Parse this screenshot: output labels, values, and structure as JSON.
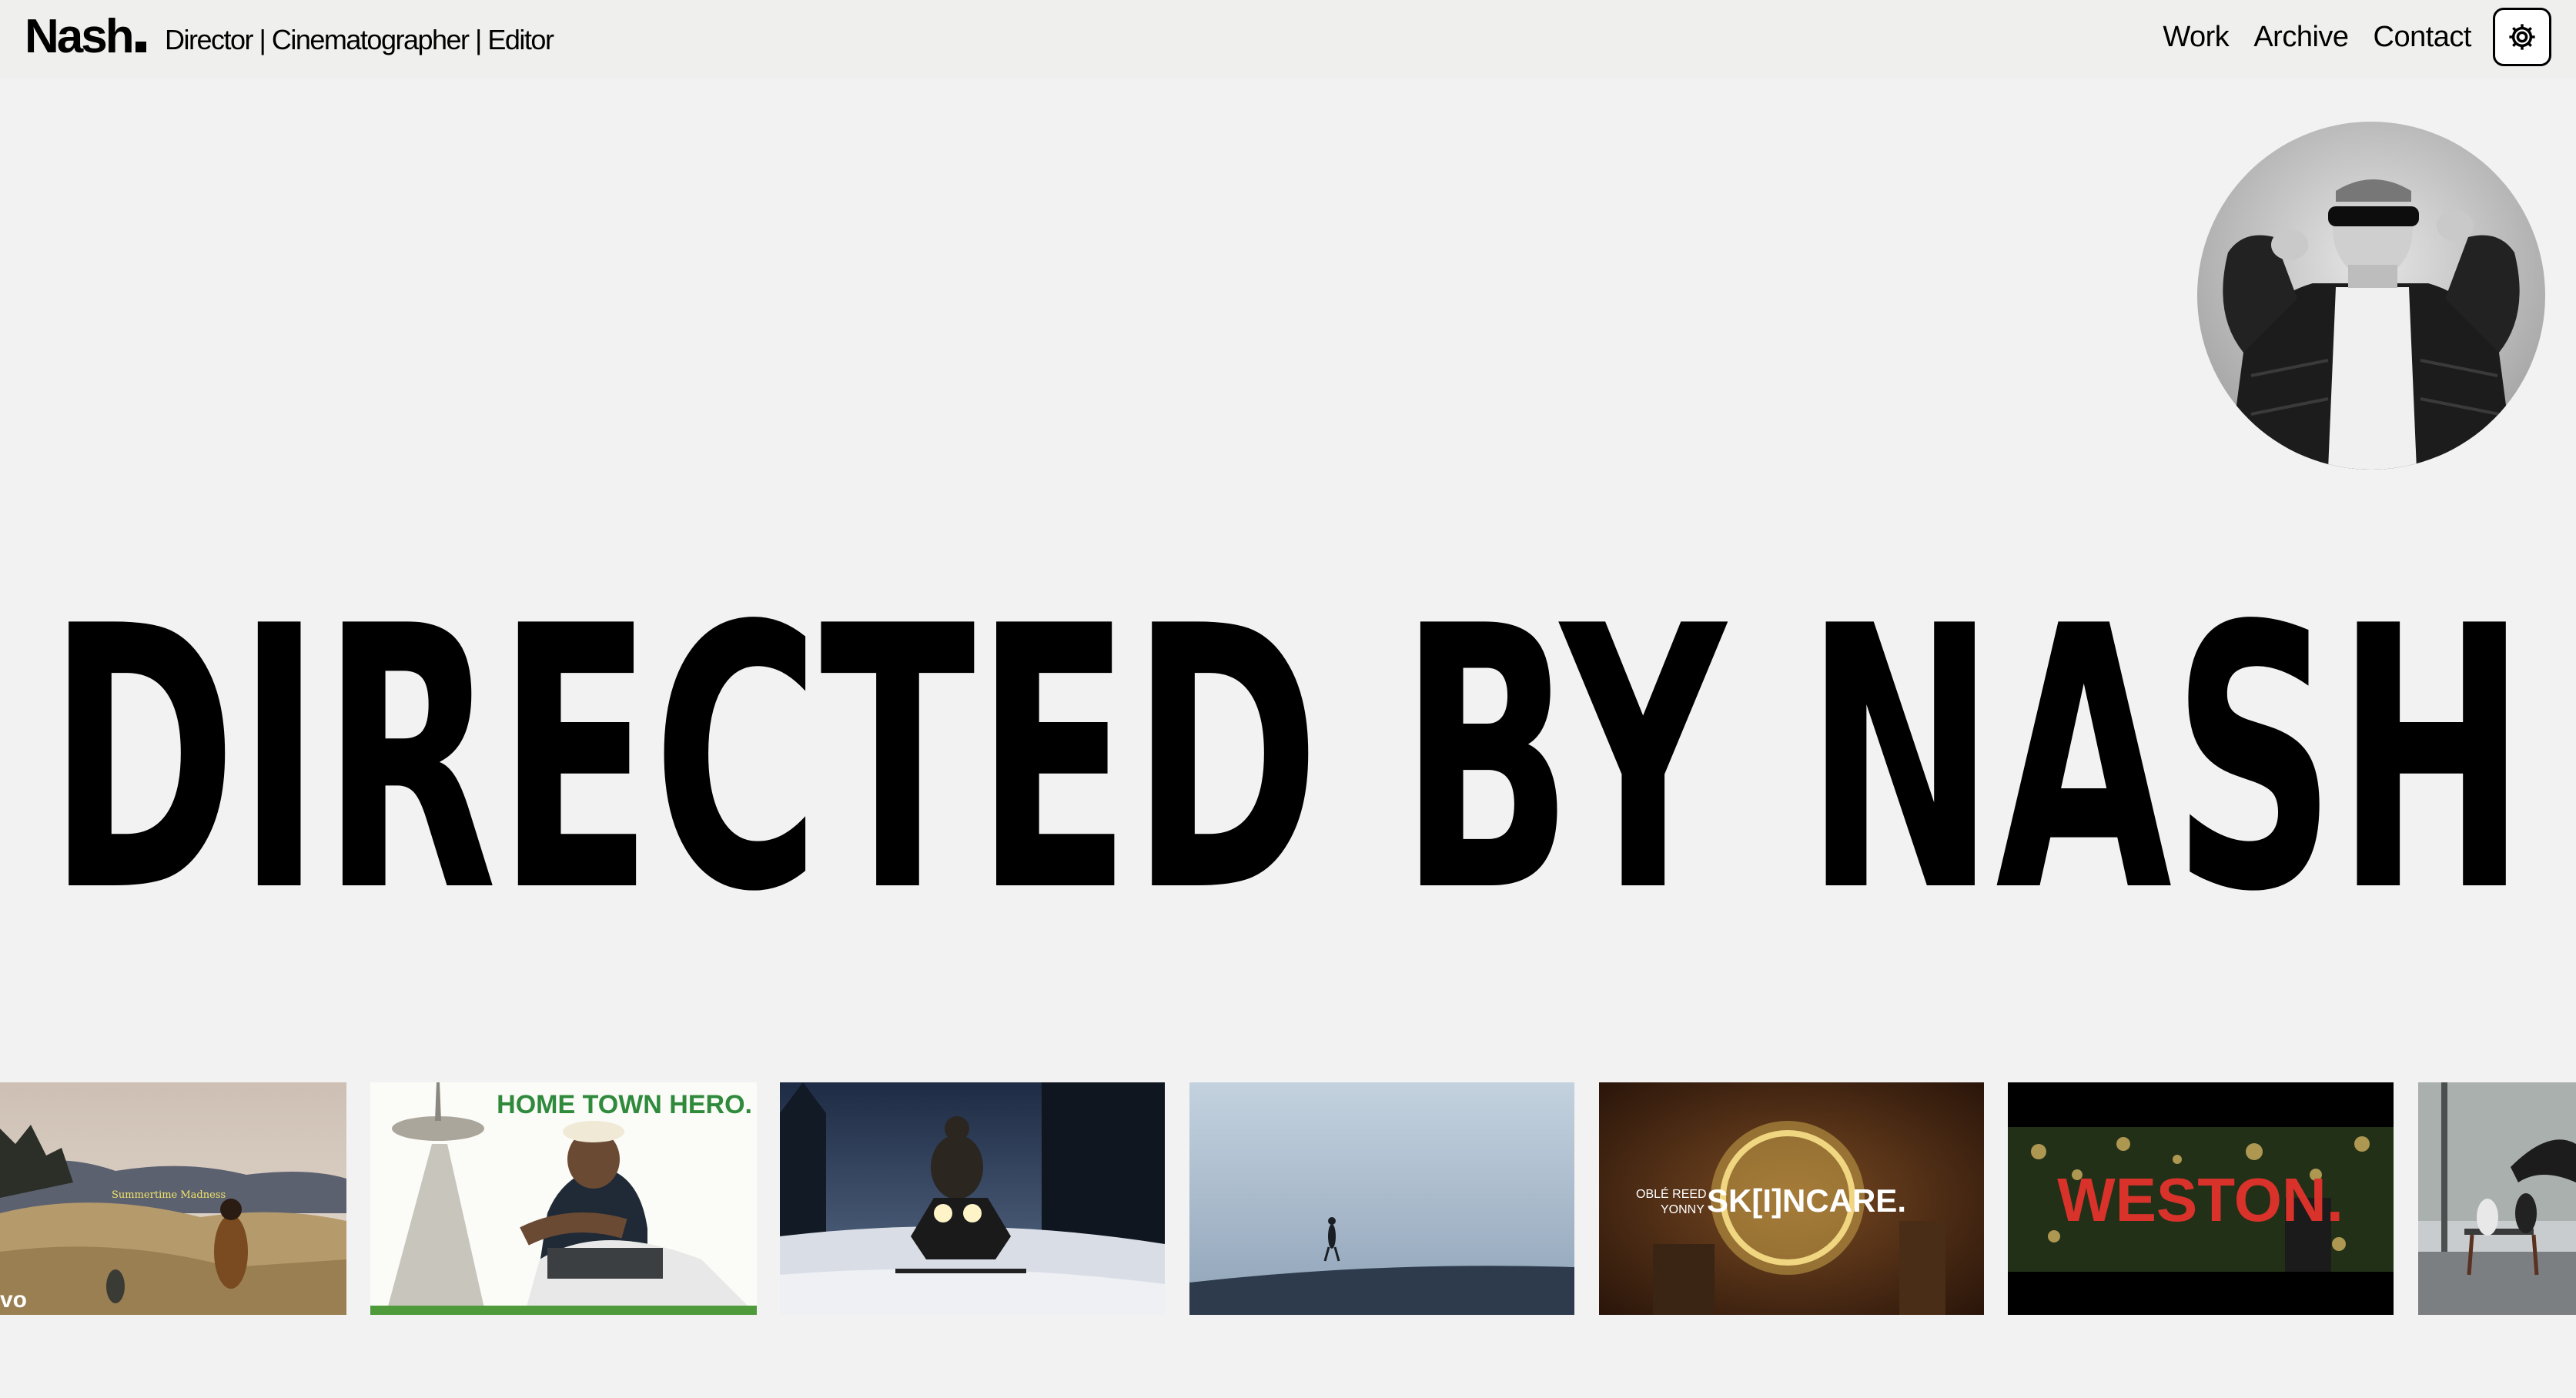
{
  "header": {
    "brand": "Nash",
    "tagline": "Director | Cinematographer | Editor",
    "nav": [
      {
        "label": "Work"
      },
      {
        "label": "Archive"
      },
      {
        "label": "Contact"
      }
    ],
    "theme_toggle_icon": "gear-icon"
  },
  "hero": {
    "headline": "DIRECTED BY NASH"
  },
  "profile": {
    "avatar_icon": "person-portrait"
  },
  "thumbnails": [
    {
      "overlay_text": "Summertime Madness",
      "badge": "vo"
    },
    {
      "overlay_text": "HOME TOWN HERO."
    },
    {
      "overlay_text": ""
    },
    {
      "overlay_text": ""
    },
    {
      "overlay_text": "SK[I]NCARE.",
      "credit_line_1": "OBLÉ REED",
      "credit_line_2": "YONNY"
    },
    {
      "overlay_text": "WESTON."
    },
    {
      "overlay_text": ""
    }
  ],
  "colors": {
    "page_background": "#f2f2f2",
    "header_background": "#efefee",
    "text": "#000000",
    "weston_red": "#d8322a",
    "hometown_green": "#2f8a3c"
  }
}
